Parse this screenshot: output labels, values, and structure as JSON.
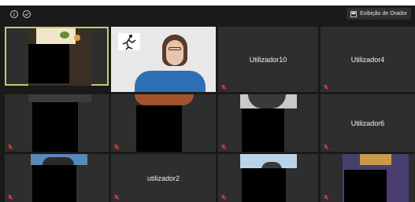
{
  "toolbar": {
    "speaker_view_label": "Exibição de Orador"
  },
  "tiles": {
    "u10": "Utilizador10",
    "u4": "Utilizador4",
    "u6": "Utilizador6",
    "u2": "utilizador2"
  },
  "colors": {
    "active_border": "#b8d36a",
    "mute_icon": "#e53935",
    "tile_bg": "#2e2e2e"
  },
  "icons": [
    "info-icon",
    "shield-check-icon",
    "grid-view-icon",
    "mic-muted-icon"
  ]
}
